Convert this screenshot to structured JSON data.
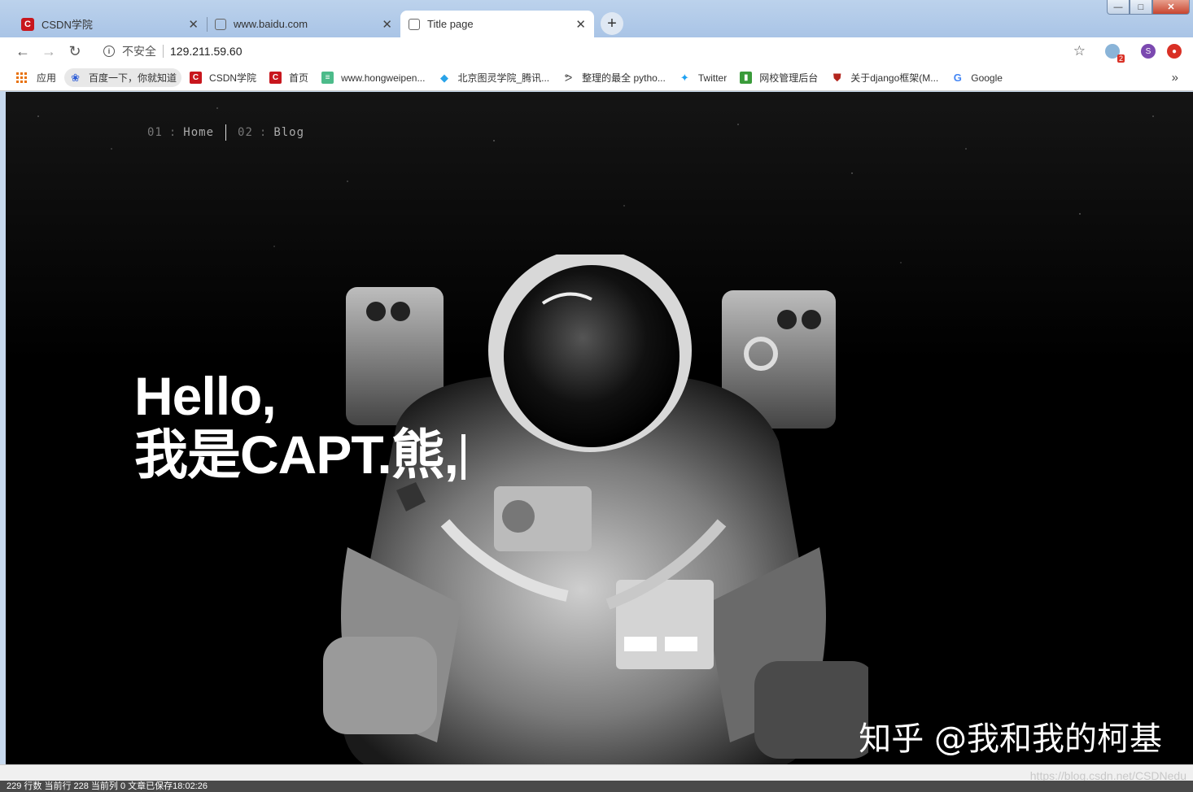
{
  "tabs": [
    {
      "label": "CSDN学院",
      "favicon": "csdn-icon"
    },
    {
      "label": "www.baidu.com",
      "favicon": "globe-icon"
    },
    {
      "label": "Title page",
      "favicon": "globe-icon"
    }
  ],
  "window_controls": {
    "minimize": "—",
    "maximize": "□",
    "close": "✕"
  },
  "address_bar": {
    "security_label": "不安全",
    "url": "129.211.59.60"
  },
  "extensions": {
    "translate_badge": "2",
    "profile_initial": "S"
  },
  "bookmarks": [
    {
      "label": "应用",
      "icon": "apps-grid-icon"
    },
    {
      "label": "百度一下，你就知道",
      "icon": "baidu-paw-icon"
    },
    {
      "label": "CSDN学院",
      "icon": "csdn-icon"
    },
    {
      "label": "首页",
      "icon": "csdn-icon"
    },
    {
      "label": "www.hongweipen...",
      "icon": "bookmark-doc-icon"
    },
    {
      "label": "北京图灵学院_腾讯...",
      "icon": "tencent-edu-icon"
    },
    {
      "label": "整理的最全 pytho...",
      "icon": "python-icon"
    },
    {
      "label": "Twitter",
      "icon": "twitter-bird-icon"
    },
    {
      "label": "网校管理后台",
      "icon": "green-doc-icon"
    },
    {
      "label": "关于django框架(M...",
      "icon": "shield-icon"
    },
    {
      "label": "Google",
      "icon": "google-g-icon"
    }
  ],
  "page": {
    "nav": [
      {
        "num": "01",
        "label": "Home"
      },
      {
        "num": "02",
        "label": "Blog"
      }
    ],
    "hero_line1": "Hello,",
    "hero_line2": "我是CAPT.熊,",
    "watermark": "知乎 @我和我的柯基"
  },
  "statusbar": {
    "text": "229 行数  当前行 228  当前列 0  文章已保存18:02:26"
  },
  "footer_url": "https://blog.csdn.net/CSDNedu",
  "colors": {
    "csdn_red": "#c8161d",
    "profile_purple": "#7b49b0",
    "ext_red": "#d93025",
    "page_bg": "#000000"
  }
}
